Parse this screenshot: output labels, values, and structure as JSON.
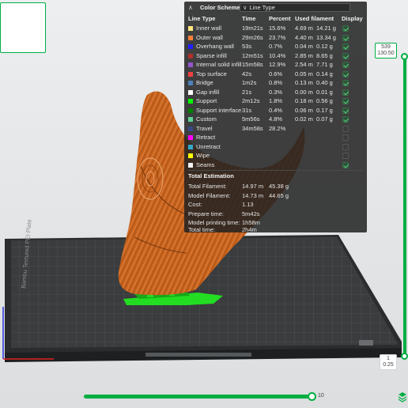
{
  "thumbnail": {
    "index": "1"
  },
  "legend": {
    "scheme_label": "Color Scheme",
    "scheme_value": "Line Type",
    "headers": {
      "type": "Line Type",
      "time": "Time",
      "percent": "Percent",
      "filament": "Used filament",
      "display": "Display"
    },
    "rows": [
      {
        "name": "Inner wall",
        "color": "#ffe680",
        "time": "19m21s",
        "percent": "15.6%",
        "length": "4.69 m",
        "weight": "14.21 g",
        "shown": true
      },
      {
        "name": "Outer wall",
        "color": "#ff7d38",
        "time": "29m26s",
        "percent": "23.7%",
        "length": "4.40 m",
        "weight": "13.34 g",
        "shown": true
      },
      {
        "name": "Overhang wall",
        "color": "#1f1fff",
        "time": "53s",
        "percent": "0.7%",
        "length": "0.04 m",
        "weight": "0.12 g",
        "shown": true
      },
      {
        "name": "Sparse infill",
        "color": "#b03029",
        "time": "12m51s",
        "percent": "10.4%",
        "length": "2.85 m",
        "weight": "8.65 g",
        "shown": true
      },
      {
        "name": "Internal solid infill",
        "color": "#9654cc",
        "time": "15m58s",
        "percent": "12.9%",
        "length": "2.54 m",
        "weight": "7.71 g",
        "shown": true
      },
      {
        "name": "Top surface",
        "color": "#f04040",
        "time": "42s",
        "percent": "0.6%",
        "length": "0.05 m",
        "weight": "0.14 g",
        "shown": true
      },
      {
        "name": "Bridge",
        "color": "#4d80ba",
        "time": "1m2s",
        "percent": "0.8%",
        "length": "0.13 m",
        "weight": "0.40 g",
        "shown": true
      },
      {
        "name": "Gap infill",
        "color": "#ffffff",
        "time": "21s",
        "percent": "0.3%",
        "length": "0.00 m",
        "weight": "0.01 g",
        "shown": true
      },
      {
        "name": "Support",
        "color": "#00ff00",
        "time": "2m12s",
        "percent": "1.8%",
        "length": "0.18 m",
        "weight": "0.56 g",
        "shown": true
      },
      {
        "name": "Support interface",
        "color": "#008000",
        "time": "31s",
        "percent": "0.4%",
        "length": "0.06 m",
        "weight": "0.17 g",
        "shown": true
      },
      {
        "name": "Custom",
        "color": "#5ed194",
        "time": "5m56s",
        "percent": "4.8%",
        "length": "0.02 m",
        "weight": "0.07 g",
        "shown": true
      },
      {
        "name": "Travel",
        "color": "#38488a",
        "time": "34m58s",
        "percent": "28.2%",
        "length": "",
        "weight": "",
        "shown": false
      },
      {
        "name": "Retract",
        "color": "#ff00ff",
        "time": "",
        "percent": "",
        "length": "",
        "weight": "",
        "shown": false
      },
      {
        "name": "Unretract",
        "color": "#34a8c9",
        "time": "",
        "percent": "",
        "length": "",
        "weight": "",
        "shown": false
      },
      {
        "name": "Wipe",
        "color": "#ffff00",
        "time": "",
        "percent": "",
        "length": "",
        "weight": "",
        "shown": false
      },
      {
        "name": "Seams",
        "color": "#f2f2f2",
        "time": "",
        "percent": "",
        "length": "",
        "weight": "",
        "shown": true
      }
    ],
    "estimation": {
      "title": "Total Estimation",
      "total_filament_label": "Total Filament:",
      "total_filament_length": "14.97 m",
      "total_filament_weight": "45.38 g",
      "model_filament_label": "Model Filament:",
      "model_filament_length": "14.73 m",
      "model_filament_weight": "44.65 g",
      "cost_label": "Cost:",
      "cost_value": "1.13",
      "prepare_label": "Prepare time:",
      "prepare_value": "5m42s",
      "model_time_label": "Model printing time:",
      "model_time_value": "1h58m",
      "total_time_label": "Total time:",
      "total_time_value": "2h4m"
    }
  },
  "vertical_slider": {
    "top_layer": "539",
    "top_height": "130.50",
    "bottom_layer": "1",
    "bottom_height": "0.25"
  },
  "horizontal_slider": {
    "value": "10"
  },
  "plate": {
    "label": "Bambu Textured PEI Plate"
  },
  "colors": {
    "accent": "#00ae42",
    "model": "#c8641e",
    "support": "#22dd22"
  }
}
